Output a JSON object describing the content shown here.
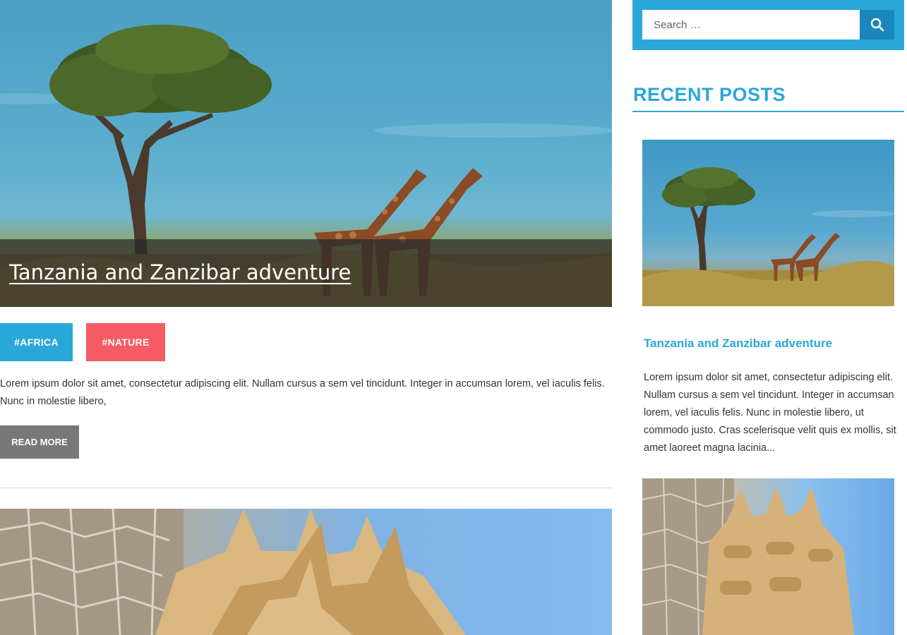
{
  "main": {
    "featured_post": {
      "title": "Tanzania and Zanzibar adventure",
      "tags": [
        "#AFRICA",
        "#NATURE"
      ],
      "excerpt": "Lorem ipsum dolor sit amet, consectetur adipiscing elit. Nullam cursus a sem vel tincidunt. Integer in accumsan lorem, vel iaculis felis. Nunc in molestie libero,",
      "read_more_label": "READ MORE"
    }
  },
  "sidebar": {
    "search": {
      "placeholder": "Search …",
      "value": ""
    },
    "recent_posts": {
      "heading": "RECENT POSTS",
      "items": [
        {
          "title": "Tanzania and Zanzibar adventure",
          "excerpt": "Lorem ipsum dolor sit amet, consectetur adipiscing elit. Nullam cursus a sem vel tincidunt. Integer in accumsan lorem, vel iaculis felis. Nunc in molestie libero, ut commodo justo. Cras scelerisque velit quis ex mollis, sit amet laoreet magna lacinia..."
        }
      ]
    }
  },
  "colors": {
    "accent": "#2aa7d9",
    "accent_dark": "#1b86bb",
    "tag_nature": "#f55b62",
    "read_more": "#787878"
  },
  "icons": {
    "search_button": "search-icon"
  }
}
